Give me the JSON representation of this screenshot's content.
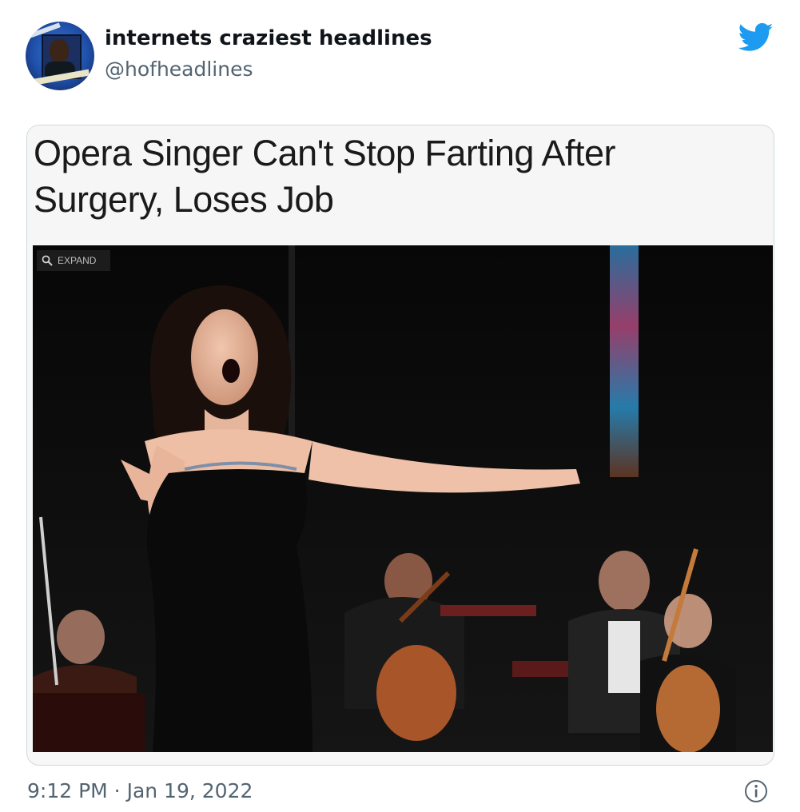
{
  "author": {
    "display_name": "internets craziest headlines",
    "handle": "@hofheadlines"
  },
  "card": {
    "headline": "Opera Singer Can't Stop Farting After Surgery, Loses Job",
    "expand_label": "EXPAND"
  },
  "tweet": {
    "timestamp": "9:12 PM · Jan 19, 2022"
  },
  "icons": {
    "platform": "twitter-bird-icon",
    "info": "info-icon",
    "expand": "magnifier-icon"
  },
  "colors": {
    "brand": "#1d9bf0",
    "secondary_text": "#536471",
    "border": "#cfd9de"
  }
}
